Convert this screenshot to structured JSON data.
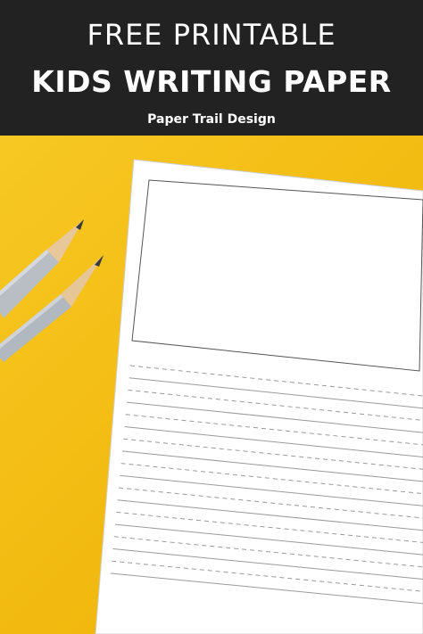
{
  "banner": {
    "line1": "FREE PRINTABLE",
    "line2": "KIDS WRITING PAPER",
    "line3": "Paper Trail Design"
  },
  "colors": {
    "banner_bg": "#222222",
    "background": "#f4c21a",
    "paper": "#ffffff",
    "pencil_body": "#b9bec5",
    "pencil_wood": "#e8c79a",
    "pencil_lead": "#3a3a3a"
  },
  "icons": [
    "pencil-icon",
    "pencil-icon"
  ]
}
